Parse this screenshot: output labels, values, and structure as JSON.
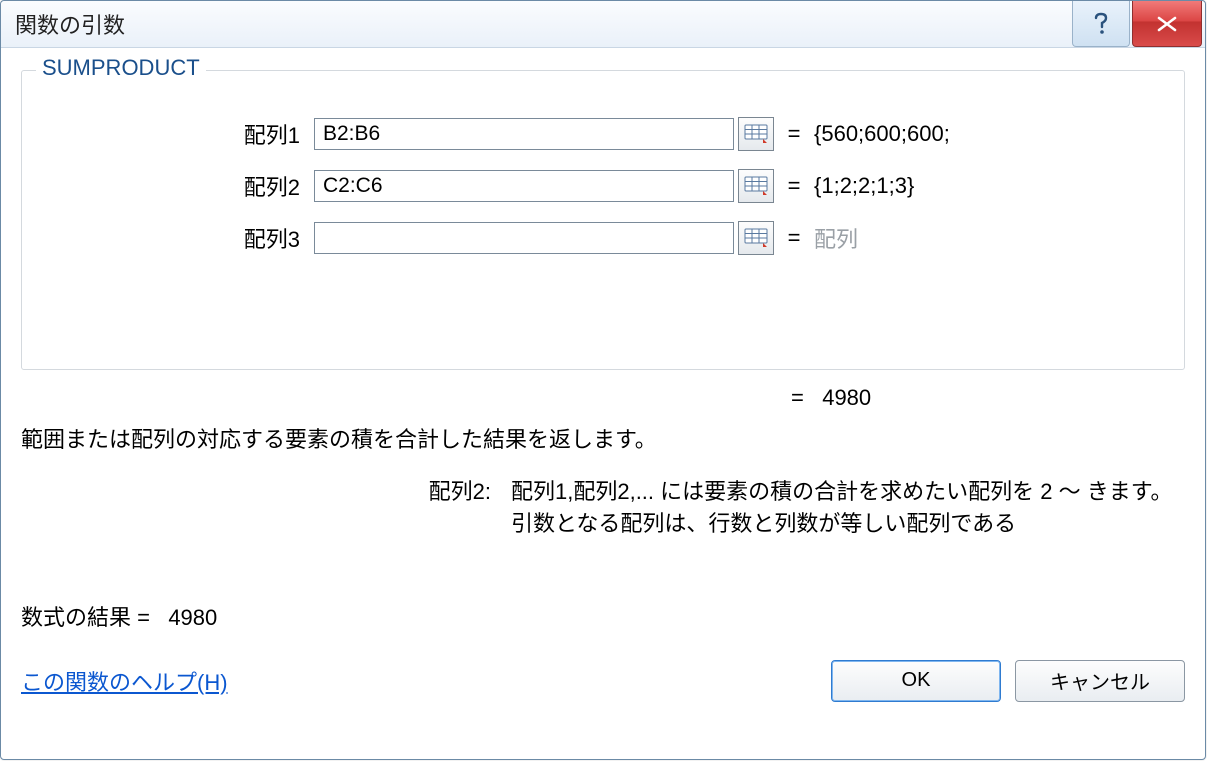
{
  "titlebar": {
    "title": "関数の引数"
  },
  "group": {
    "legend": "SUMPRODUCT",
    "args": [
      {
        "label": "配列1",
        "value": "B2:B6",
        "preview": "{560;600;600;",
        "placeholder": ""
      },
      {
        "label": "配列2",
        "value": "C2:C6",
        "preview": "{1;2;2;1;3}",
        "placeholder": ""
      },
      {
        "label": "配列3",
        "value": "",
        "preview": "配列",
        "placeholder": ""
      }
    ]
  },
  "eq_symbol": "=",
  "center_result": "4980",
  "description": "範囲または配列の対応する要素の積を合計した結果を返します。",
  "arg_help": {
    "label": "配列2:",
    "text": "配列1,配列2,... には要素の積の合計を求めたい配列を 2 〜 きます。引数となる配列は、行数と列数が等しい配列である"
  },
  "formula_result": {
    "label": "数式の結果 =",
    "value": "4980"
  },
  "help_link": "この関数のヘルプ(H)",
  "buttons": {
    "ok": "OK",
    "cancel": "キャンセル"
  }
}
